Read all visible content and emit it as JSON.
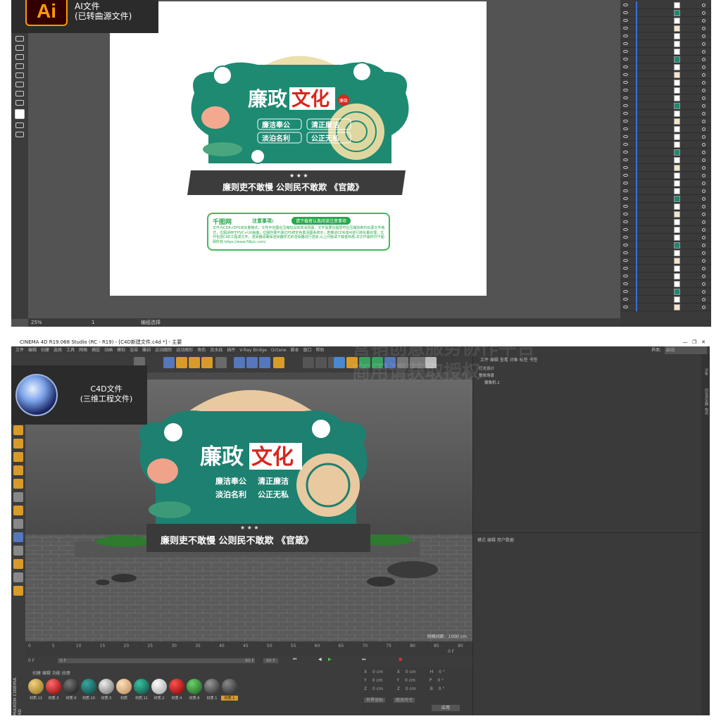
{
  "ai": {
    "badge_logo": "Ai",
    "badge_line1": "AI文件",
    "badge_line2": "(已转曲源文件)",
    "status_zoom": "25%",
    "status_page": "1",
    "status_text": "编组选择"
  },
  "sign": {
    "title_1": "廉政",
    "title_2": "文化",
    "seal": "廉政",
    "phrase_1": "廉洁奉公",
    "phrase_2": "清正廉洁",
    "phrase_3": "淡泊名利",
    "phrase_4": "公正无私",
    "slogan": "廉则吏不敢慢 公则民不敢欺 《官箴》",
    "stars": "★ ★ ★"
  },
  "notice": {
    "brand": "千图网",
    "title": "注意事项:",
    "pill": "请下载者认真阅读注意事项",
    "body": "文件为CDR+EPS双矢量格式，文件中包图在压缩包具有高清原图，文字需要在图层可在压缩找到PSD源文件格式，位图适用于PVC+UV画面，位图所展可通过PS修定色置清图系统示，若推进CDR成AI进行转矢量处理，文件包括C4D工程源文件，渲染器请确保渲染器样式的渲染器进行渲染,以上问题请下载者知悉,本文件版权归千图网所有,https://www.58pic.com/"
  },
  "c4d": {
    "title": "CINEMA 4D R19.068 Studio (RC - R19) - [C4D新建文件.c4d *] - 主要",
    "badge_line1": "C4D文件",
    "badge_line2": "(三维工程文件)",
    "menus": [
      "文件",
      "编辑",
      "创建",
      "选择",
      "工具",
      "网格",
      "捕捉",
      "动画",
      "模拟",
      "渲染",
      "雕刻",
      "运动跟踪",
      "运动图形",
      "角色",
      "流水线",
      "插件",
      "V-Ray Bridge",
      "Octane",
      "脚本",
      "窗口",
      "帮助"
    ],
    "layout_label": "界面:",
    "layout_value": "启动",
    "viewport_menu": "查看  摄像机  显示  选项  过滤  面板  ProRender",
    "grid_note": "网格间距 : 1000 cm",
    "timeline_ticks": [
      "0",
      "5",
      "10",
      "15",
      "20",
      "25",
      "30",
      "35",
      "40",
      "45",
      "50",
      "55",
      "60",
      "65",
      "70",
      "75",
      "80",
      "85",
      "90"
    ],
    "frame_end": "0 F",
    "frame_start": "0 F",
    "frame_field": "0 F",
    "frame_max": "90 F",
    "frame_max2": "90 F",
    "mat_menu": "创建  编辑  功能  纹理",
    "materials": [
      "材质.12",
      "材质.3",
      "材质.9",
      "材质.10",
      "材质.5",
      "材质",
      "材质.11",
      "材质.2",
      "材质.4",
      "材质.8",
      "材质.1",
      "材质.1"
    ],
    "maxon": "MAXON CINEMA 4D",
    "coords": {
      "x_label": "X",
      "x1": "0 cm",
      "x2": "0 cm",
      "h_label": "H",
      "h": "0 °",
      "y_label": "Y",
      "y1": "0 cm",
      "y2": "0 cm",
      "p_label": "P",
      "p": "0 °",
      "z_label": "Z",
      "z1": "0 cm",
      "z2": "0 cm",
      "b_label": "B",
      "b": "0 °",
      "mode1": "世界坐标",
      "mode2": "绝对尺寸",
      "apply": "应用"
    },
    "object_tabs": "文件  编辑  查看  对象  标签  书签",
    "objects": [
      "灯光设计",
      "整体场景",
      "摄像机.1"
    ],
    "attr_tabs": "模式  编辑  用户数据",
    "right_tabs": [
      "对象",
      "内容浏览器",
      "构造"
    ]
  },
  "watermark_line1": "营销创意服务协作平台",
  "watermark_line2": "商用请获取授权"
}
